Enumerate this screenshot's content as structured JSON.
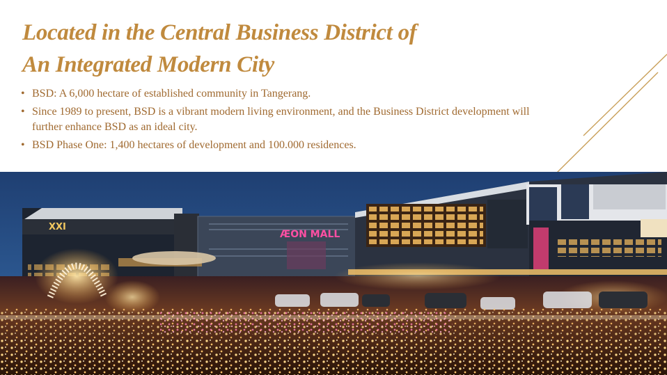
{
  "title": {
    "line1": "Located in the Central Business District of",
    "line2": "An Integrated Modern City"
  },
  "bullets": [
    "BSD: A 6,000 hectare of established community in Tangerang.",
    "Since 1989 to present, BSD is a vibrant modern living environment, and the Business District development will further enhance BSD as an ideal city.",
    "BSD Phase One: 1,400 hectares of development and 100.000 residences."
  ],
  "photo": {
    "sign_cinema": "XXI",
    "sign_mall": "ÆON MALL"
  },
  "colors": {
    "accent": "#c08a3e",
    "text": "#a06a30",
    "sky": "#2a4f86"
  }
}
